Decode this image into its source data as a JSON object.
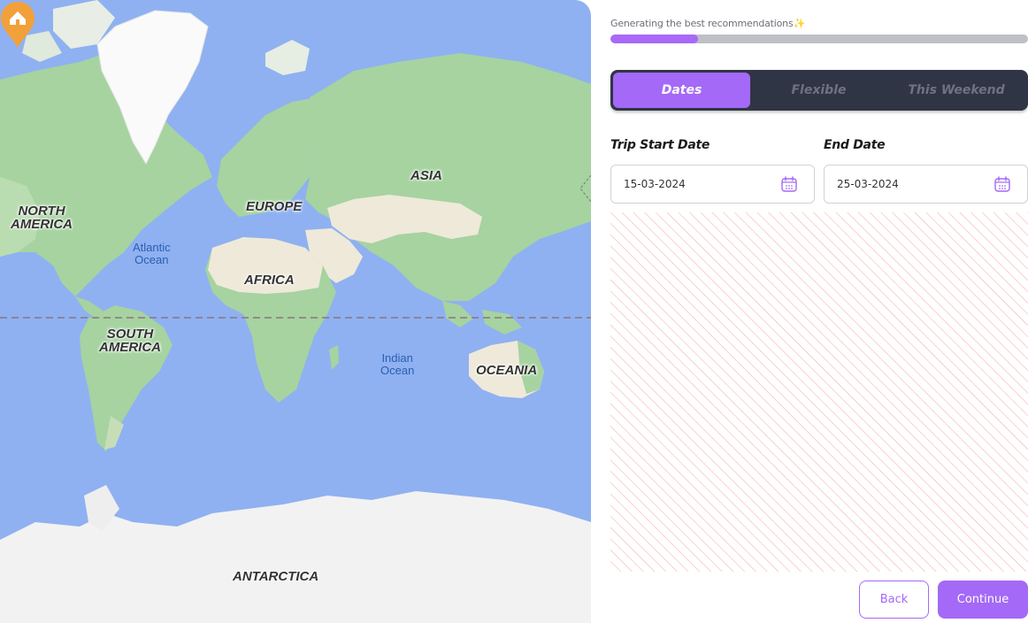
{
  "map": {
    "continents": {
      "north_america": "NORTH\nAMERICA",
      "south_america": "SOUTH\nAMERICA",
      "europe": "EUROPE",
      "asia": "ASIA",
      "africa": "AFRICA",
      "oceania": "OCEANIA",
      "antarctica": "ANTARCTICA"
    },
    "oceans": {
      "atlantic": "Atlantic\nOcean",
      "indian": "Indian\nOcean"
    },
    "marker_icon": "home-location-pin-icon"
  },
  "progress": {
    "label": "Generating the best recommendations",
    "sparkle": "✨",
    "fraction": 0.21
  },
  "tabs": [
    {
      "label": "Dates",
      "active": true
    },
    {
      "label": "Flexible",
      "active": false
    },
    {
      "label": "This Weekend",
      "active": false
    }
  ],
  "form": {
    "start": {
      "label": "Trip Start Date",
      "value": "15-03-2024",
      "icon": "calendar-icon"
    },
    "end": {
      "label": "End Date",
      "value": "25-03-2024",
      "icon": "calendar-icon"
    }
  },
  "actions": {
    "back_label": "Back",
    "continue_label": "Continue"
  },
  "colors": {
    "accent": "#a469f6",
    "ocean": "#8fb1f1",
    "land": "#a6d3a0",
    "desert": "#f1ece0",
    "ice": "#f4f4f4",
    "pin": "#f2a03a",
    "hatch": "#f5a7a7"
  }
}
